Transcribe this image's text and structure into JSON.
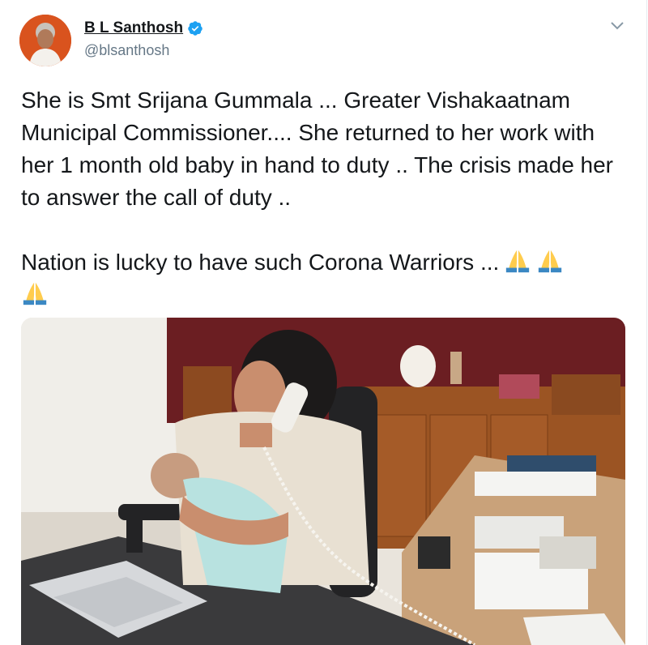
{
  "author": {
    "display_name": "B L Santhosh",
    "handle": "@blsanthosh",
    "verified": true,
    "avatar_icon": "profile-photo"
  },
  "tweet": {
    "paragraph1": "She is Smt Srijana Gummala ... Greater Vishakaatnam Municipal Commissioner.... She returned to her work with her 1 month old baby in hand to duty .. The crisis made her to answer the call of duty ..",
    "paragraph2": "Nation is lucky to have such Corona Warriors ...",
    "emoji": [
      "folded-hands-icon",
      "folded-hands-icon",
      "folded-hands-icon"
    ]
  },
  "media": {
    "kind": "photo",
    "subject_icon": "office-photo"
  },
  "colors": {
    "text": "#14171a",
    "secondary": "#657786",
    "verified": "#1da1f2",
    "avatar_bg": "#d9531e"
  }
}
